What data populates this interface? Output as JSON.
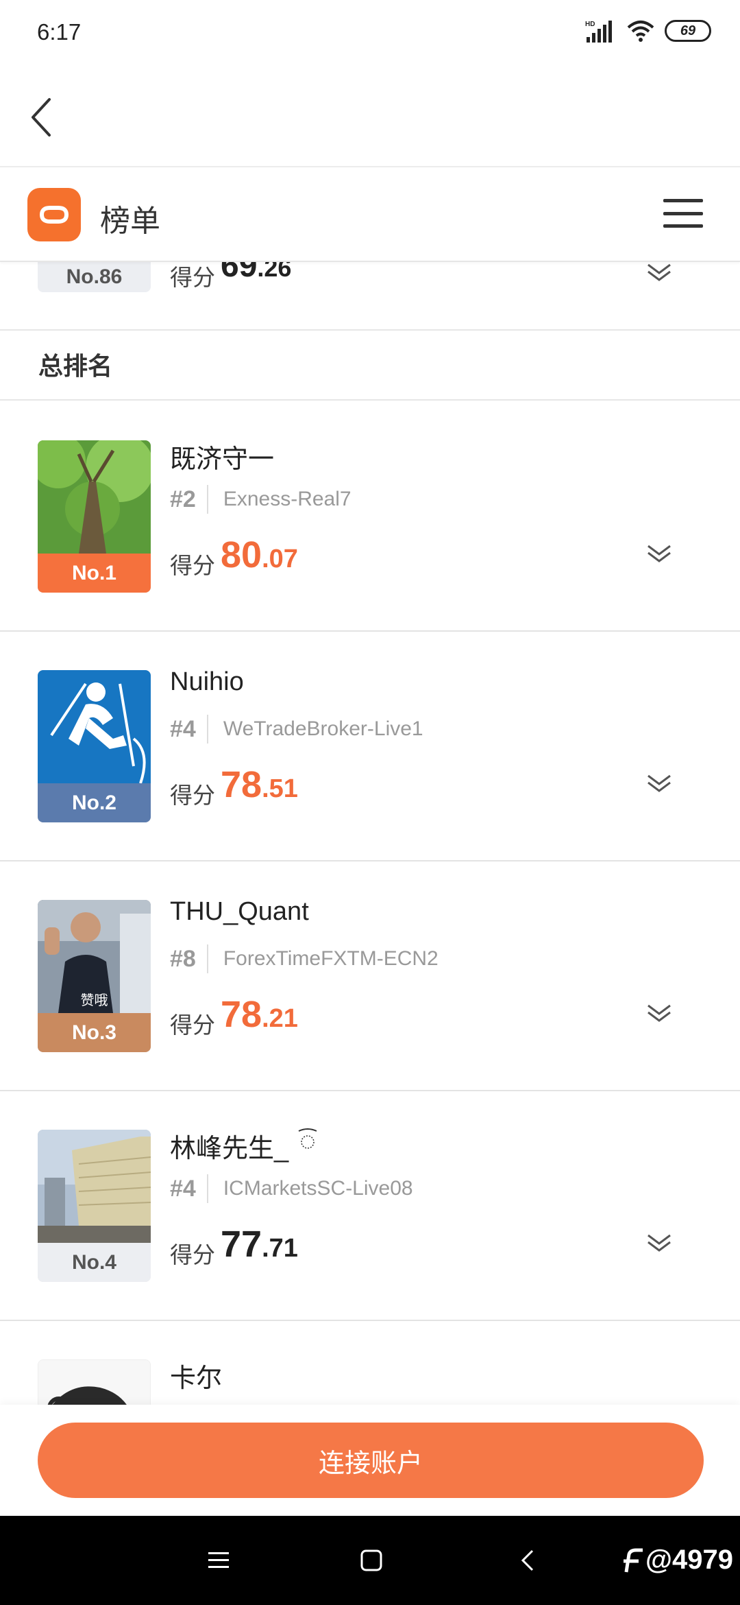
{
  "status_bar": {
    "time": "6:17",
    "battery": "69",
    "network": "HD"
  },
  "header": {
    "title": "榜单"
  },
  "partial_row": {
    "badge": "No.86",
    "score_label": "得分",
    "score_int": "69",
    "score_dec": ".26"
  },
  "section_title": "总排名",
  "rankings": [
    {
      "name": "既济守一",
      "rank": "#2",
      "server": "Exness-Real7",
      "badge": "No.1",
      "badge_color": "#f5713d",
      "score_label": "得分",
      "score_int": "80",
      "score_dec": ".07",
      "score_color": "#f26b3a"
    },
    {
      "name": "Nuihio",
      "rank": "#4",
      "server": "WeTradeBroker-Live1",
      "badge": "No.2",
      "badge_color": "#5b7bad",
      "score_label": "得分",
      "score_int": "78",
      "score_dec": ".51",
      "score_color": "#f26b3a"
    },
    {
      "name": "THU_Quant",
      "rank": "#8",
      "server": "ForexTimeFXTM-ECN2",
      "badge": "No.3",
      "badge_color": "#c98a5f",
      "score_label": "得分",
      "score_int": "78",
      "score_dec": ".21",
      "score_color": "#f26b3a",
      "avatar_caption": "赞哦"
    },
    {
      "name": "林峰先生_",
      "rank": "#4",
      "server": "ICMarketsSC-Live08",
      "badge": "No.4",
      "badge_color": "#eceef2",
      "badge_text_color": "#555555",
      "score_label": "得分",
      "score_int": "77",
      "score_dec": ".71",
      "score_color": "#222222"
    },
    {
      "name": "卡尔"
    }
  ],
  "cta": {
    "label": "连接账户"
  },
  "watermark": "@4979"
}
